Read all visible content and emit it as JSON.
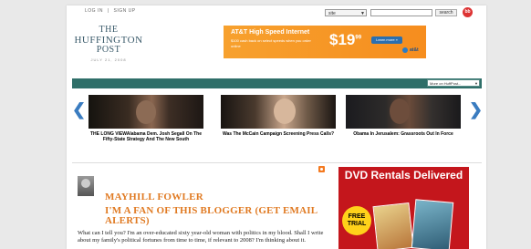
{
  "topbar": {
    "login_label": "LOG IN",
    "separator": "|",
    "signup_label": "SIGN UP",
    "site_select_value": "site",
    "search_button": "search",
    "bb_logo": "bb"
  },
  "logo": {
    "line1": "THE",
    "line2": "HUFFINGTON",
    "line3": "POST",
    "date": "JULY 21, 2008"
  },
  "ad": {
    "headline": "AT&T High Speed Internet",
    "subtext": "$100 cash back on select speeds when you order online",
    "price": "$19",
    "price_cents": "99",
    "cta": "Learn more »",
    "brand": "at&t"
  },
  "nav": {
    "items": [
      "HOME",
      "POLITICS",
      "MEDIA",
      "BUSINESS",
      "ENTERTAINMENT",
      "LIFE",
      "GREEN",
      "23/6"
    ],
    "more_select": "More on HuffPost..."
  },
  "carousel": {
    "prev_glyph": "❮",
    "next_glyph": "❯",
    "stories": [
      {
        "caption": "THE LONG VIEWAlabama Dem. Josh Segall On The Fifty-State Strategy And The New South"
      },
      {
        "caption": "Was The McCain Campaign Screening Press Calls?"
      },
      {
        "caption": "Obama In Jerusalem: Grassroots Out In Force"
      }
    ]
  },
  "blogger": {
    "name": "MAYHILL FOWLER",
    "fan_line": "I'M A FAN OF THIS BLOGGER (GET EMAIL ALERTS)",
    "bio": "What can I tell you? I'm an over-educated sixty year-old woman with politics in my blood. Shall I write about my family's political fortunes from time to time, if relevant to 2008? I'm thinking about it."
  },
  "dvd_ad": {
    "title": "DVD Rentals Delivered",
    "badge": "FREE TRIAL"
  },
  "colors": {
    "nav_bg": "#2f6f69",
    "accent_orange": "#e07a22",
    "arrow_blue": "#3a7cc0",
    "dvd_red": "#c4161c"
  }
}
